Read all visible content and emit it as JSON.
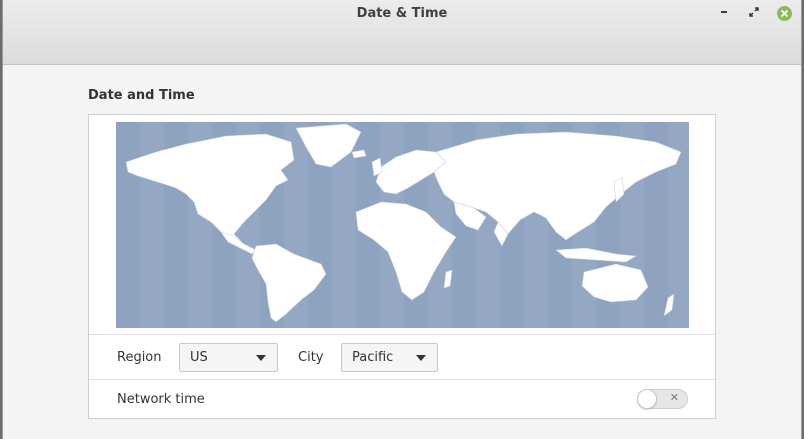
{
  "window": {
    "title": "Date & Time",
    "controls": {
      "minimize": "minimize-icon",
      "maximize": "maximize-icon",
      "close": "close-icon"
    }
  },
  "section": {
    "title": "Date and Time"
  },
  "map": {
    "icon": "world-timezone-map"
  },
  "region": {
    "label": "Region",
    "value": "US"
  },
  "city": {
    "label": "City",
    "value": "Pacific"
  },
  "network_time": {
    "label": "Network time",
    "enabled": false
  },
  "colors": {
    "ocean": "#94a8c4",
    "land": "#ffffff",
    "close_button": "#8fb859"
  }
}
